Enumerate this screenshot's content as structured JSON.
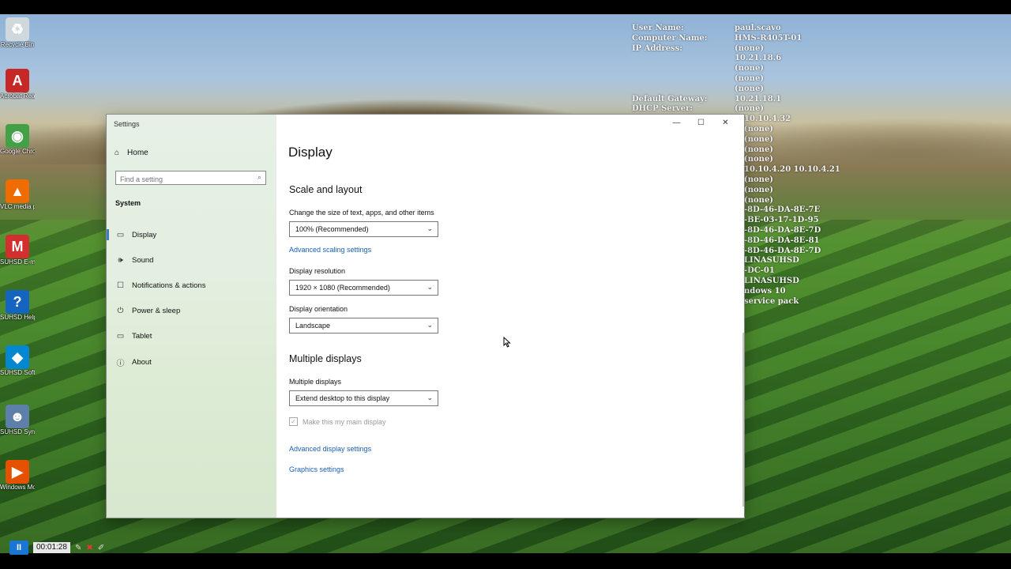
{
  "desktop_icons": [
    {
      "label": "Recycle Bin",
      "glyph": "♻",
      "color": "#cfd8dc"
    },
    {
      "label": "Acrobat Reader DC",
      "glyph": "A",
      "color": "#c62828"
    },
    {
      "label": "Google Chrome",
      "glyph": "◉",
      "color": "#43a047"
    },
    {
      "label": "VLC media player",
      "glyph": "▲",
      "color": "#ef6c00"
    },
    {
      "label": "SUHSD E-mail",
      "glyph": "M",
      "color": "#d32f2f"
    },
    {
      "label": "SUHSD Helpdesk",
      "glyph": "?",
      "color": "#1565c0"
    },
    {
      "label": "SUHSD Softwa...",
      "glyph": "◆",
      "color": "#0288d1"
    },
    {
      "label": "SUHSD Synergy",
      "glyph": "☻",
      "color": "#5e7fa8"
    },
    {
      "label": "Windows Movie Maker",
      "glyph": "▶",
      "color": "#e65100"
    }
  ],
  "bginfo": [
    [
      "User Name:",
      "paul.scavo"
    ],
    [
      "Computer Name:",
      "HMS-R405T-01"
    ],
    [
      "IP Address:",
      "(none)"
    ],
    [
      "",
      "10.21.18.6"
    ],
    [
      "",
      "(none)"
    ],
    [
      "",
      "(none)"
    ],
    [
      "",
      "(none)"
    ],
    [
      "Default Gateway:",
      "10.21.18.1"
    ],
    [
      "DHCP Server:",
      "(none)"
    ],
    [
      "",
      "10.10.4.32"
    ],
    [
      "",
      "(none)"
    ],
    [
      "",
      "(none)"
    ],
    [
      "",
      "(none)"
    ],
    [
      "",
      "(none)"
    ],
    [
      "",
      "10.10.4.20 10.10.4.21"
    ],
    [
      "",
      "(none)"
    ],
    [
      "",
      "(none)"
    ],
    [
      "",
      "(none)"
    ],
    [
      "",
      "-8D-46-DA-8E-7E"
    ],
    [
      "",
      "-BE-03-17-1D-95"
    ],
    [
      "",
      "-8D-46-DA-8E-7D"
    ],
    [
      "",
      "-8D-46-DA-8E-81"
    ],
    [
      "",
      "-8D-46-DA-8E-7D"
    ],
    [
      "",
      "LINASUHSD"
    ],
    [
      "",
      "-DC-01"
    ],
    [
      "",
      "LINASUHSD"
    ],
    [
      "",
      "ndows 10"
    ],
    [
      "",
      "service pack"
    ]
  ],
  "window": {
    "title": "Settings",
    "controls": {
      "minimize": "—",
      "maximize": "☐",
      "close": "✕"
    }
  },
  "sidebar": {
    "home": "Home",
    "home_icon": "home-icon",
    "search_placeholder": "Find a setting",
    "section": "System",
    "items": [
      {
        "label": "Display",
        "icon": "▭",
        "selected": true
      },
      {
        "label": "Sound",
        "icon": "🕪"
      },
      {
        "label": "Notifications & actions",
        "icon": "☐"
      },
      {
        "label": "Power & sleep",
        "icon": "⏻"
      },
      {
        "label": "Tablet",
        "icon": "▭"
      },
      {
        "label": "About",
        "icon": "ⓘ"
      }
    ]
  },
  "main": {
    "title": "Display",
    "scale_heading": "Scale and layout",
    "scale_label": "Change the size of text, apps, and other items",
    "scale_value": "100% (Recommended)",
    "advanced_scaling": "Advanced scaling settings",
    "resolution_label": "Display resolution",
    "resolution_value": "1920 × 1080 (Recommended)",
    "orientation_label": "Display orientation",
    "orientation_value": "Landscape",
    "multi_heading": "Multiple displays",
    "multi_label": "Multiple displays",
    "multi_value": "Extend desktop to this display",
    "main_display_label": "Make this my main display",
    "main_display_checked": true,
    "advanced_display": "Advanced display settings",
    "graphics_settings": "Graphics settings"
  },
  "recorder": {
    "time": "00:01:28"
  }
}
